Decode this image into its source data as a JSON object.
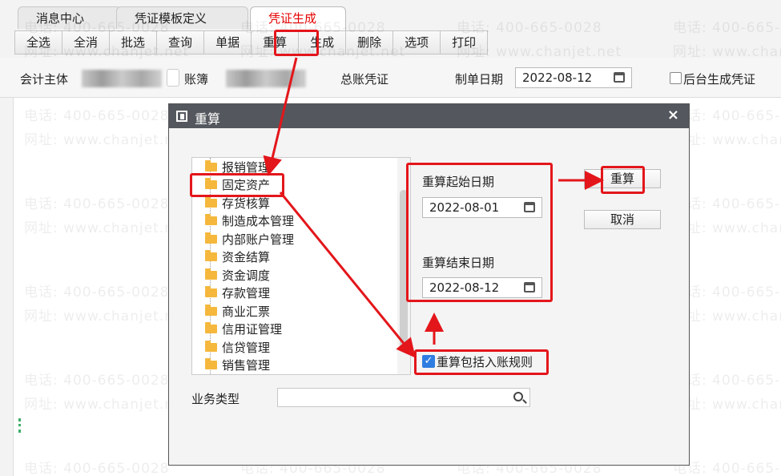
{
  "tabs": [
    {
      "label": "消息中心"
    },
    {
      "label": "凭证模板定义"
    },
    {
      "label": "凭证生成",
      "active": true
    }
  ],
  "toolbar": {
    "buttons": [
      "全选",
      "全消",
      "批选",
      "查询",
      "单据",
      "重算",
      "生成",
      "删除",
      "选项",
      "打印"
    ]
  },
  "form": {
    "entity_label": "会计主体",
    "book_label": "账簿",
    "gl_voucher_label": "总账凭证",
    "date_label": "制单日期",
    "date_value": "2022-08-12",
    "background_label": "后台生成凭证"
  },
  "watermark": {
    "phone": "电话: 400-665-0028",
    "site": "网址: www.chanjet.net"
  },
  "dialog": {
    "title": "重算",
    "close": "×",
    "tree": [
      "报销管理",
      "固定资产",
      "存货核算",
      "制造成本管理",
      "内部账户管理",
      "资金结算",
      "资金调度",
      "存款管理",
      "商业汇票",
      "信用证管理",
      "信贷管理",
      "销售管理"
    ],
    "start_label": "重算起始日期",
    "start_value": "2022-08-01",
    "end_label": "重算结束日期",
    "end_value": "2022-08-12",
    "recalc_button": "重算",
    "cancel_button": "取消",
    "include_rule_label": "重算包括入账规则",
    "include_rule_checked": true,
    "biz_type_label": "业务类型"
  },
  "colors": {
    "annotation_red": "#e3161b",
    "active_tab_text": "#e60000",
    "dialog_title_bg": "#54585e",
    "checkbox_blue": "#2f7de1",
    "folder": "#f5b83d"
  }
}
